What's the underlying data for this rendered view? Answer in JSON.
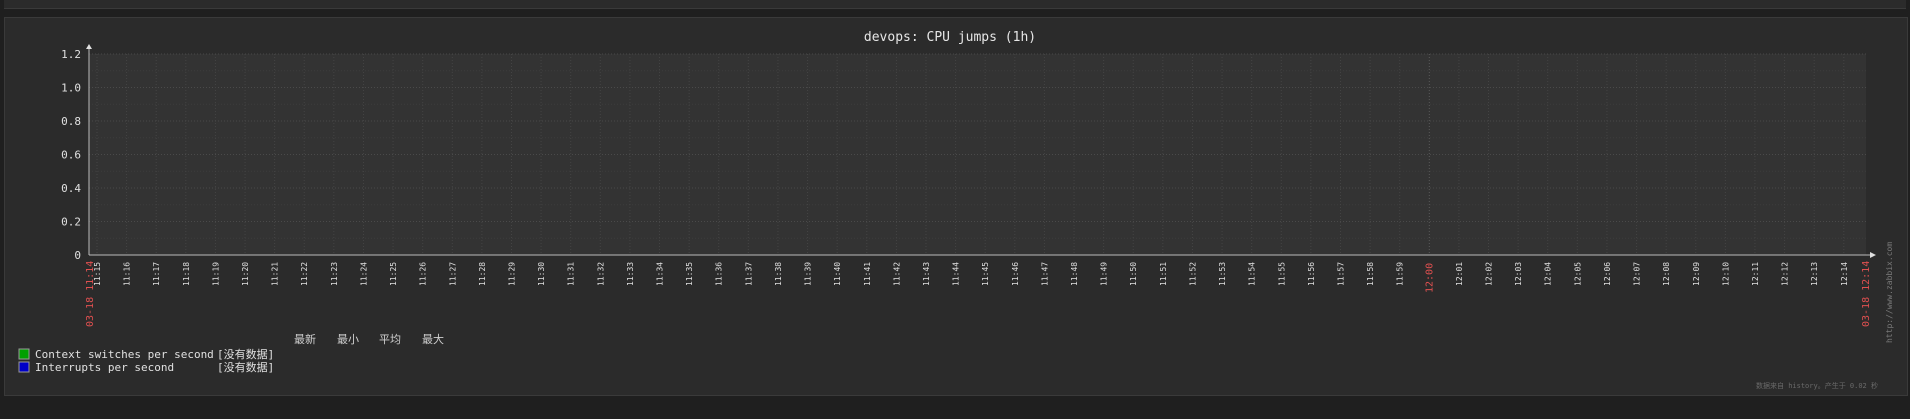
{
  "chart_data": {
    "type": "line",
    "title": "devops: CPU jumps (1h)",
    "y_ticks": [
      "0",
      "0.2",
      "0.4",
      "0.6",
      "0.8",
      "1.0",
      "1.2"
    ],
    "ylim": [
      0,
      1.2
    ],
    "x_ticks": [
      "11:15",
      "11:16",
      "11:17",
      "11:18",
      "11:19",
      "11:20",
      "11:21",
      "11:22",
      "11:23",
      "11:24",
      "11:25",
      "11:26",
      "11:27",
      "11:28",
      "11:29",
      "11:30",
      "11:31",
      "11:32",
      "11:33",
      "11:34",
      "11:35",
      "11:36",
      "11:37",
      "11:38",
      "11:39",
      "11:40",
      "11:41",
      "11:42",
      "11:43",
      "11:44",
      "11:45",
      "11:46",
      "11:47",
      "11:48",
      "11:49",
      "11:50",
      "11:51",
      "11:52",
      "11:53",
      "11:54",
      "11:55",
      "11:56",
      "11:57",
      "11:58",
      "11:59",
      "12:00",
      "12:01",
      "12:02",
      "12:03",
      "12:04",
      "12:05",
      "12:06",
      "12:07",
      "12:08",
      "12:09",
      "12:10",
      "12:11",
      "12:12",
      "12:13",
      "12:14"
    ],
    "x_highlight": "12:00",
    "x_start_label": "03-18 11:14",
    "x_end_label": "03-18 12:14",
    "legend_headers": [
      "最新",
      "最小",
      "平均",
      "最大"
    ],
    "series": [
      {
        "name": "Context switches per second",
        "color": "#00a000",
        "status": "[没有数据]",
        "values": []
      },
      {
        "name": "Interrupts per second",
        "color": "#0000c8",
        "status": "[没有数据]",
        "values": []
      }
    ],
    "watermark": "http://www.zabbix.com",
    "footer_note": "数据来自 history。产生于 0.02 秒"
  }
}
